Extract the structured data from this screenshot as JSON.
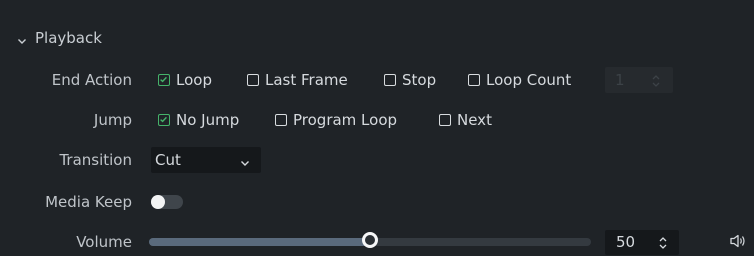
{
  "playback": {
    "title": "Playback",
    "end_action": {
      "label": "End Action",
      "options": [
        {
          "label": "Loop",
          "checked": true
        },
        {
          "label": "Last Frame",
          "checked": false
        },
        {
          "label": "Stop",
          "checked": false
        },
        {
          "label": "Loop Count",
          "checked": false
        }
      ],
      "loop_count_value": "1"
    },
    "jump": {
      "label": "Jump",
      "options": [
        {
          "label": "No Jump",
          "checked": true
        },
        {
          "label": "Program Loop",
          "checked": false
        },
        {
          "label": "Next",
          "checked": false
        }
      ]
    },
    "transition": {
      "label": "Transition",
      "value": "Cut"
    },
    "media_keep": {
      "label": "Media Keep",
      "on": false
    },
    "volume": {
      "label": "Volume",
      "value": "50",
      "level": 0.5
    }
  },
  "icons": {
    "collapse": "chevron-down-icon",
    "speaker": "speaker-icon"
  },
  "colors": {
    "background": "#1f2327",
    "check_accent": "#45b36a",
    "slider_fill": "#5a6a7c",
    "input_bg": "#15181b"
  }
}
